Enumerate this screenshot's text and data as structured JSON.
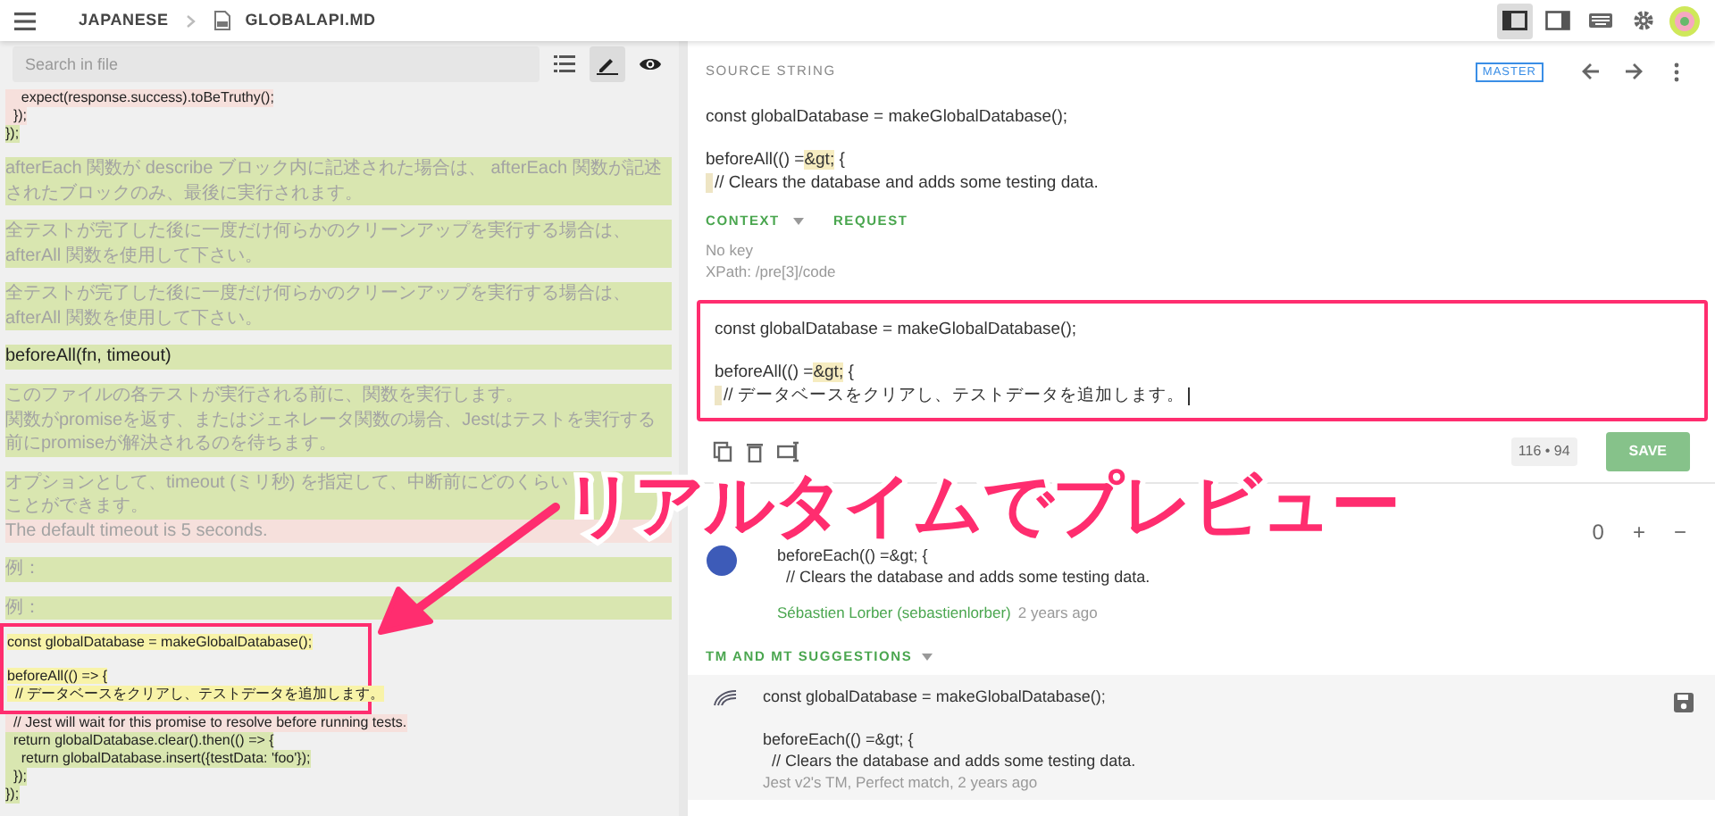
{
  "topbar": {
    "language": "JAPANESE",
    "file": "GLOBALAPI.MD",
    "layouts": [
      {
        "kind": "sidebar-left",
        "selected": true
      },
      {
        "kind": "sidebar-right",
        "selected": false
      },
      {
        "kind": "keyboard",
        "selected": false
      },
      {
        "kind": "settings",
        "selected": false
      }
    ]
  },
  "file_toolbar": {
    "placeholder": "Search in file",
    "tools": [
      {
        "kind": "list",
        "selected": false
      },
      {
        "kind": "edit",
        "selected": true
      },
      {
        "kind": "preview",
        "selected": false
      }
    ]
  },
  "preview_blocks": [
    {
      "kind": "code",
      "parts": [
        {
          "text": "    expect(response.success).toBeTruthy();",
          "color": "#f6e0dc"
        },
        {
          "text": "  });",
          "color": "#f6e0dc"
        },
        {
          "text": "});",
          "color": "#d9e6b0"
        }
      ]
    },
    {
      "kind": "paragraph",
      "parts": [
        {
          "text": "afterEach 関数が describe ブロック内に記述された場合は、 afterEach 関数が記述されたブロックのみ、最後に実行されます。",
          "color": "#d9e6b0"
        }
      ]
    },
    {
      "kind": "paragraph",
      "parts": [
        {
          "text": "全テストが完了した後に一度だけ何らかのクリーンアップを実行する場合は、 afterAll 関数を使用して下さい。",
          "color": "#d9e6b0"
        }
      ]
    },
    {
      "kind": "paragraph",
      "parts": [
        {
          "text": "全テストが完了した後に一度だけ何らかのクリーンアップを実行する場合は、 afterAll 関数を使用して下さい。",
          "color": "#d9e6b0"
        }
      ]
    },
    {
      "kind": "heading",
      "parts": [
        {
          "text": "beforeAll(fn, timeout)",
          "color": "#d9e6b0"
        }
      ]
    },
    {
      "kind": "paragraph",
      "parts": [
        {
          "text": "このファイルの各テストが実行される前に、関数を実行します。",
          "color": "#d9e6b0"
        },
        {
          "text": "関数がpromiseを返す、またはジェネレータ関数の場合、Jestはテストを実行する前にpromiseが解決されるのを待ちます。",
          "color": "#d9e6b0"
        }
      ]
    },
    {
      "kind": "paragraph",
      "parts": [
        {
          "text": "オプションとして、timeout (ミリ秒) を指定して、中断前にどのくらい",
          "color": "#d9e6b0"
        },
        {
          "text": "ことができます。",
          "color": "#d9e6b0"
        },
        {
          "text": "The default timeout is 5 seconds.",
          "color": "#f6e0dc"
        }
      ]
    },
    {
      "kind": "paragraph",
      "parts": [
        {
          "text": "例：",
          "color": "#d9e6b0"
        }
      ]
    },
    {
      "kind": "paragraph",
      "parts": [
        {
          "text": "例：",
          "color": "#d9e6b0"
        }
      ]
    },
    {
      "kind": "code",
      "parts": [
        {
          "text": "const globalDatabase = makeGlobalDatabase();",
          "color": "#f8f3a8",
          "framed": true
        },
        {
          "text": "beforeAll(() => {",
          "color": "#f8f3a8",
          "framed": true,
          "space_before": true
        },
        {
          "text": "  // データベースをクリアし、テストデータを追加します。",
          "color": "#f8f3a8",
          "framed": true
        },
        {
          "text": "  // Jest will wait for this promise to resolve before running tests.",
          "color": "#f6e0dc",
          "framed": false
        },
        {
          "text": "  return globalDatabase.clear().then(() => {",
          "color": "#d9e6b0",
          "framed": false
        },
        {
          "text": "    return globalDatabase.insert({testData: 'foo'});",
          "color": "#d9e6b0",
          "framed": false
        },
        {
          "text": "  });",
          "color": "#d9e6b0",
          "framed": false
        },
        {
          "text": "});",
          "color": "#d9e6b0",
          "framed": false
        }
      ]
    }
  ],
  "source": {
    "label": "SOURCE STRING",
    "branch": "MASTER",
    "lines": [
      {
        "segments": [
          {
            "text": "const globalDatabase = makeGlobalDatabase();"
          }
        ]
      },
      {
        "space_before": true,
        "segments": [
          {
            "text": "beforeAll(() ="
          },
          {
            "text": "&gt;",
            "tag": true
          },
          {
            "text": " {"
          }
        ]
      },
      {
        "indent": true,
        "segments": [
          {
            "text": "// Clears the database and adds some testing data."
          }
        ]
      }
    ]
  },
  "context_tabs": [
    {
      "label": "CONTEXT",
      "dropdown": true
    },
    {
      "label": "REQUEST",
      "dropdown": false
    }
  ],
  "context_lines": [
    "No key",
    "XPath: /pre[3]/code"
  ],
  "editor": {
    "lines": [
      {
        "segments": [
          {
            "text": "const globalDatabase = makeGlobalDatabase();"
          }
        ]
      },
      {
        "space_before": true,
        "segments": [
          {
            "text": "beforeAll(() ="
          },
          {
            "text": "&gt;",
            "tag": true
          },
          {
            "text": " {"
          }
        ]
      },
      {
        "indent": true,
        "cursor": true,
        "segments": [
          {
            "text": "// データベースをクリアし、テストデータを追加します。"
          }
        ]
      }
    ],
    "counter": "116 • 94",
    "save": "SAVE"
  },
  "translations": [
    {
      "lines": [
        "beforeEach(() =&gt; {",
        "  // Clears the database and adds some testing data."
      ],
      "author": "Sébastien Lorber (sebastienlorber)",
      "time": "2 years ago",
      "votes": "0",
      "vote_up": "+",
      "vote_down": "−"
    }
  ],
  "suggestions_heading": "TM AND MT SUGGESTIONS",
  "suggestions": [
    {
      "lines": [
        "const globalDatabase = makeGlobalDatabase();",
        "beforeEach(() =&gt; {",
        "  // Clears the database and adds some testing data."
      ],
      "meta": "Jest v2's TM, Perfect match, 2 years ago"
    }
  ],
  "callout": "リアルタイムでプレビュー"
}
